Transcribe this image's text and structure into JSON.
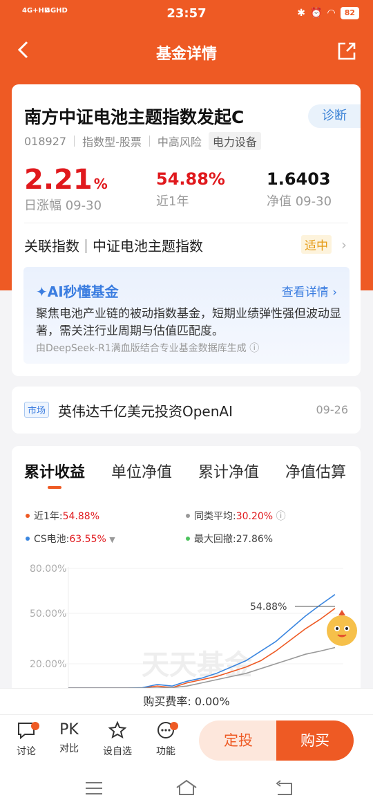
{
  "status": {
    "sig1": "4G+HD",
    "sig2": "4GHD",
    "time": "23:57",
    "battery": "82"
  },
  "nav": {
    "title": "基金详情"
  },
  "fund": {
    "name": "南方中证电池主题指数发起C",
    "code": "018927",
    "type": "指数型-股票",
    "risk": "中高风险",
    "sector": "电力设备",
    "diagnose_label": "诊断"
  },
  "stats": {
    "daily_value": "2.21",
    "daily_unit": "%",
    "daily_label": "日涨幅 09-30",
    "year_value": "54.88%",
    "year_label": "近1年",
    "nav_value": "1.6403",
    "nav_label": "净值 09-30"
  },
  "related": {
    "label": "关联指数",
    "index": "中证电池主题指数",
    "fit": "适中"
  },
  "ai": {
    "title": "AI秒懂基金",
    "more": "查看详情",
    "body": "聚焦电池产业链的被动指数基金，短期业绩弹性强但波动显著，需关注行业周期与估值匹配度。",
    "gen": "由DeepSeek-R1满血版结合专业基金数据库生成"
  },
  "news": {
    "badge": "市场",
    "text": "英伟达千亿美元投资OpenAI",
    "date": "09-26"
  },
  "chart_tabs": [
    "累计收益",
    "单位净值",
    "累计净值",
    "净值估算"
  ],
  "legend": {
    "fund_label": "近1年:",
    "fund_value": "54.88%",
    "peer_label": "同类平均:",
    "peer_value": "30.20%",
    "index_label": "CS电池:",
    "index_value": "63.55%",
    "dd_label": "最大回撤:",
    "dd_value": "27.86%"
  },
  "colors": {
    "fund": "#ee5a24",
    "index": "#3a86e0",
    "peer": "#999999",
    "drawdown": "#4cc35d"
  },
  "chart_data": {
    "type": "line",
    "yticks": [
      "80.00%",
      "50.00%",
      "20.00%"
    ],
    "ylim": [
      -10,
      80
    ],
    "callout": "54.88%",
    "watermark": "天天基金",
    "series": [
      {
        "name": "近1年",
        "values": [
          0,
          2,
          -2,
          3,
          1,
          4,
          6,
          5,
          8,
          10,
          12,
          15,
          18,
          22,
          28,
          35,
          42,
          48,
          54.88
        ]
      },
      {
        "name": "CS电池",
        "values": [
          0,
          3,
          -1,
          4,
          2,
          5,
          7,
          6,
          9,
          11,
          14,
          18,
          22,
          28,
          34,
          42,
          50,
          57,
          63.55
        ]
      },
      {
        "name": "同类平均",
        "values": [
          0,
          1,
          0,
          2,
          2,
          3,
          4,
          5,
          6,
          8,
          10,
          12,
          14,
          17,
          20,
          23,
          26,
          28,
          30.2
        ]
      }
    ]
  },
  "fee": {
    "label": "购买费率:",
    "value": "0.00%"
  },
  "bottom": {
    "discuss": "讨论",
    "pk_icon": "PK",
    "pk": "对比",
    "watch": "设自选",
    "func": "功能",
    "dingtou": "定投",
    "buy": "购买"
  }
}
